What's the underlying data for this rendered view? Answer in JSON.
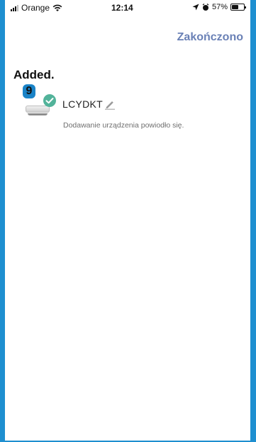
{
  "status_bar": {
    "carrier": "Orange",
    "time": "12:14",
    "battery": "57%",
    "battery_level": 0.57,
    "icons": [
      "signal-icon",
      "wifi-icon",
      "location-icon",
      "alarm-icon",
      "battery-icon"
    ]
  },
  "nav": {
    "done_label": "Zakończono"
  },
  "page": {
    "title": "Added."
  },
  "annotation": {
    "step_number": "9"
  },
  "device": {
    "name": "LCYDKT",
    "status_message": "Dodawanie urządzenia powiodło się.",
    "icons": [
      "device-icon",
      "check-icon",
      "edit-pencil-icon"
    ]
  },
  "colors": {
    "accent": "#6a81b6",
    "success": "#52b39a",
    "badge": "#1a83c7",
    "frame": "#1e8fd0"
  }
}
